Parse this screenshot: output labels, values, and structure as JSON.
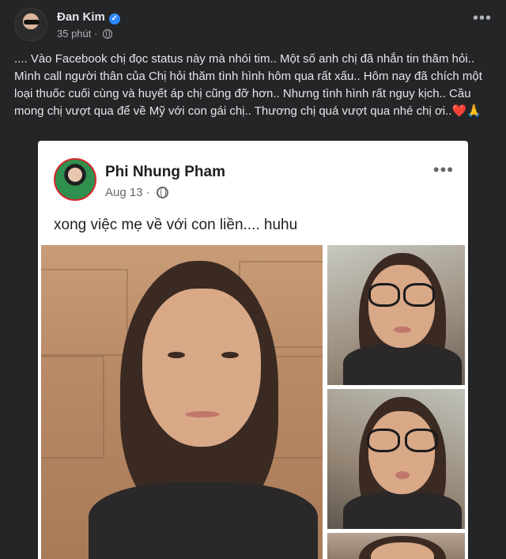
{
  "outer_post": {
    "author": "Đan Kim",
    "time": "35 phút",
    "body": ".... Vào Facebook chị đọc status này mà nhói tim.. Một số anh chị đã nhắn tin thăm hỏi.. Mình call người thân của Chị hỏi thăm tình hình hôm qua rất xấu.. Hôm nay đã chích một loại thuốc cuối cùng và huyết áp chị cũng đỡ hơn.. Nhưng tình hình rất nguy kịch.. Cầu mong chị vượt qua để về Mỹ với con gái chị.. Thương chị quá vượt qua nhé chị ơi..❤️🙏"
  },
  "shared_post": {
    "author": "Phi Nhung Pham",
    "date": "Aug 13",
    "body": "xong việc mẹ về với con liền.... huhu"
  },
  "icons": {
    "verified": "verified-badge-icon",
    "privacy": "globe-icon",
    "menu": "more-options-icon"
  },
  "colors": {
    "background": "#242526",
    "card": "#ffffff",
    "verified": "#2d88ff",
    "muted_text": "#b0b3b8"
  }
}
